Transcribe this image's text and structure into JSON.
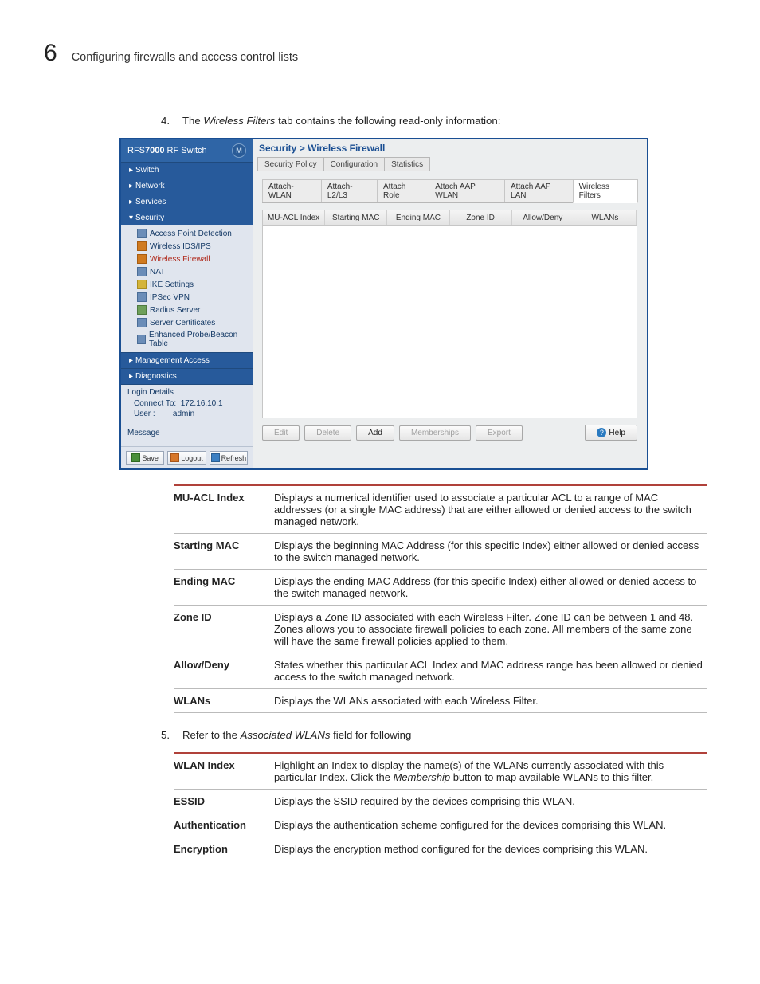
{
  "header": {
    "chapter": "6",
    "title": "Configuring firewalls and access control lists"
  },
  "step4": {
    "num": "4.",
    "prefix": "The ",
    "em": "Wireless Filters",
    "suffix": " tab contains the following read-only information:"
  },
  "screenshot": {
    "brand_prefix": "RFS",
    "brand_bold": "7000",
    "brand_suffix": " RF Switch",
    "sidebar": {
      "items": [
        {
          "label": "Switch"
        },
        {
          "label": "Network"
        },
        {
          "label": "Services"
        },
        {
          "label": "Security",
          "expanded": true
        },
        {
          "label": "Management Access"
        },
        {
          "label": "Diagnostics"
        }
      ],
      "security_children": [
        "Access Point Detection",
        "Wireless IDS/IPS",
        "Wireless Firewall",
        "NAT",
        "IKE Settings",
        "IPSec VPN",
        "Radius Server",
        "Server Certificates",
        "Enhanced Probe/Beacon Table"
      ],
      "login": {
        "title": "Login Details",
        "connect_label": "Connect To:",
        "connect_value": "172.16.10.1",
        "user_label": "User :",
        "user_value": "admin"
      },
      "message_title": "Message",
      "buttons": {
        "save": "Save",
        "logout": "Logout",
        "refresh": "Refresh"
      }
    },
    "main": {
      "breadcrumb": "Security > Wireless Firewall",
      "tabs": [
        "Security Policy",
        "Configuration",
        "Statistics"
      ],
      "subtabs": [
        "Attach-WLAN",
        "Attach-L2/L3",
        "Attach Role",
        "Attach AAP WLAN",
        "Attach AAP LAN",
        "Wireless Filters"
      ],
      "active_subtab": "Wireless Filters",
      "columns": [
        "MU-ACL Index",
        "Starting MAC",
        "Ending MAC",
        "Zone ID",
        "Allow/Deny",
        "WLANs"
      ],
      "buttons": {
        "edit": "Edit",
        "delete": "Delete",
        "add": "Add",
        "memberships": "Memberships",
        "export": "Export",
        "help": "Help"
      }
    }
  },
  "fields1": [
    {
      "k": "MU-ACL Index",
      "v": "Displays a numerical identifier used to associate a particular ACL to a range of MAC addresses (or a single MAC address) that are either allowed or denied access to the switch managed network."
    },
    {
      "k": "Starting MAC",
      "v": "Displays the beginning MAC Address (for this specific Index) either allowed or denied access to the switch managed network."
    },
    {
      "k": "Ending MAC",
      "v": "Displays the ending MAC Address (for this specific Index) either allowed or denied access to the switch managed network."
    },
    {
      "k": "Zone ID",
      "v": "Displays a Zone ID associated with each Wireless Filter. Zone ID can be between 1 and 48. Zones allows you to associate firewall policies to each zone. All members of the same zone will have the same firewall policies applied to them."
    },
    {
      "k": "Allow/Deny",
      "v": "States whether this particular ACL Index and MAC address range has been allowed or denied access to the switch managed network."
    },
    {
      "k": "WLANs",
      "v": "Displays the WLANs associated with each Wireless Filter."
    }
  ],
  "step5": {
    "num": "5.",
    "prefix": "Refer to the ",
    "em": "Associated WLANs",
    "suffix": " field for following"
  },
  "fields2": [
    {
      "k": "WLAN Index",
      "v_pre": "Highlight an Index to display the name(s) of the WLANs currently associated with this particular Index. Click the ",
      "v_em": "Membership",
      "v_post": " button to map available WLANs to this filter."
    },
    {
      "k": "ESSID",
      "v": "Displays the SSID required by the devices comprising this WLAN."
    },
    {
      "k": "Authentication",
      "v": "Displays the authentication scheme configured for the devices comprising this WLAN."
    },
    {
      "k": "Encryption",
      "v": "Displays the encryption method configured for the devices comprising this WLAN."
    }
  ]
}
